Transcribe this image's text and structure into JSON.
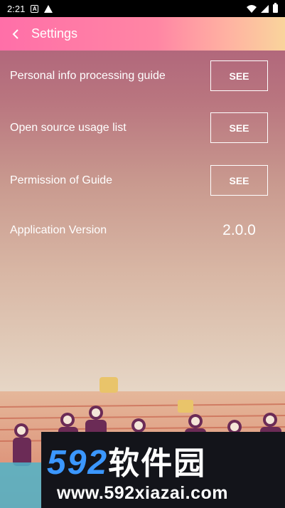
{
  "status": {
    "time": "2:21",
    "notif_icons": [
      "a-icon",
      "warning-icon"
    ],
    "right_icons": [
      "wifi-icon",
      "signal-icon",
      "battery-icon"
    ]
  },
  "appbar": {
    "title": "Settings",
    "gradient": [
      "#ff6fa8",
      "#f9d49c"
    ]
  },
  "settings": {
    "rows": [
      {
        "label": "Personal info processing guide",
        "button": "SEE"
      },
      {
        "label": "Open source usage list",
        "button": "SEE"
      },
      {
        "label": "Permission of Guide",
        "button": "SEE"
      }
    ],
    "version": {
      "label": "Application Version",
      "value": "2.0.0"
    }
  },
  "watermark": {
    "line1_num": "592",
    "line1_cn": "软件园",
    "line2": "www.592xiazai.com"
  }
}
